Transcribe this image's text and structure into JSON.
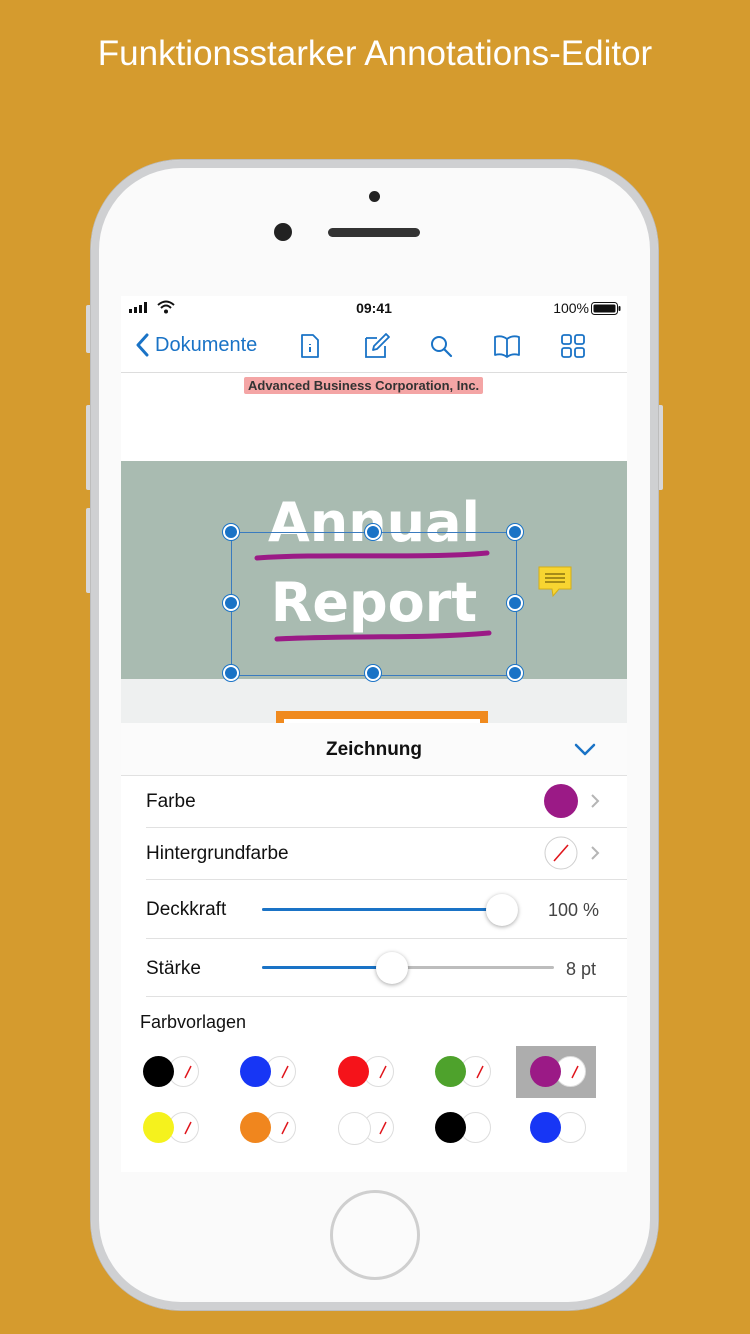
{
  "headline": "Funktionsstarker Annotations-Editor",
  "status_bar": {
    "time": "09:41",
    "battery": "100%"
  },
  "navbar": {
    "back_label": "Dokumente",
    "icons": [
      "document-info-icon",
      "annotate-icon",
      "search-icon",
      "book-icon",
      "grid-icon"
    ]
  },
  "document": {
    "company": "Advanced Business Corporation, Inc.",
    "title_line1": "Annual",
    "title_line2": "Report"
  },
  "panel": {
    "title": "Zeichnung",
    "rows": {
      "color_label": "Farbe",
      "color_value": "#9B1A86",
      "background_label": "Hintergrundfarbe",
      "opacity_label": "Deckkraft",
      "opacity_value": "100 %",
      "opacity_fraction": 1.0,
      "thickness_label": "Stärke",
      "thickness_value": "8 pt",
      "thickness_fraction": 0.44
    },
    "presets_label": "Farbvorlagen",
    "presets": [
      {
        "fill": "#000000",
        "bg": "none"
      },
      {
        "fill": "#1736F5",
        "bg": "none"
      },
      {
        "fill": "#F5131A",
        "bg": "none"
      },
      {
        "fill": "#4EA22C",
        "bg": "none"
      },
      {
        "fill": "#9B1A86",
        "bg": "none",
        "selected": true
      },
      {
        "fill": "#F5F21D",
        "bg": "none"
      },
      {
        "fill": "#F0861E",
        "bg": "none"
      },
      {
        "fill": "#FFFFFF",
        "bg": "none"
      },
      {
        "fill": "#000000",
        "bg": "#FFFFFF"
      },
      {
        "fill": "#1736F5",
        "bg": "#FFFFFF"
      }
    ]
  },
  "colors": {
    "accent": "#1A73C6",
    "page_background": "#D59B2E",
    "annotation": "#9B1A86"
  }
}
